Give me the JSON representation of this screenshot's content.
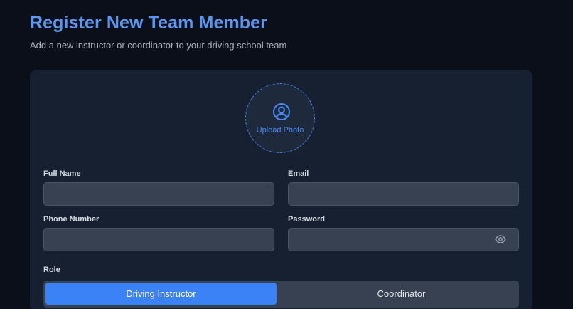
{
  "header": {
    "title": "Register New Team Member",
    "subtitle": "Add a new instructor or coordinator to your driving school team"
  },
  "photo": {
    "icon": "user-circle-icon",
    "label": "Upload Photo"
  },
  "fields": {
    "full_name": {
      "label": "Full Name",
      "value": "",
      "placeholder": ""
    },
    "email": {
      "label": "Email",
      "value": "",
      "placeholder": ""
    },
    "phone": {
      "label": "Phone Number",
      "value": "",
      "placeholder": ""
    },
    "password": {
      "label": "Password",
      "value": "",
      "placeholder": "",
      "toggle_icon": "eye-icon"
    }
  },
  "role": {
    "label": "Role",
    "options": [
      "Driving Instructor",
      "Coordinator"
    ],
    "selected": "Driving Instructor"
  },
  "colors": {
    "accent": "#3b82f6",
    "title": "#5b97f0",
    "background": "#0b0f1a",
    "card": "#172030",
    "input": "#374151"
  }
}
